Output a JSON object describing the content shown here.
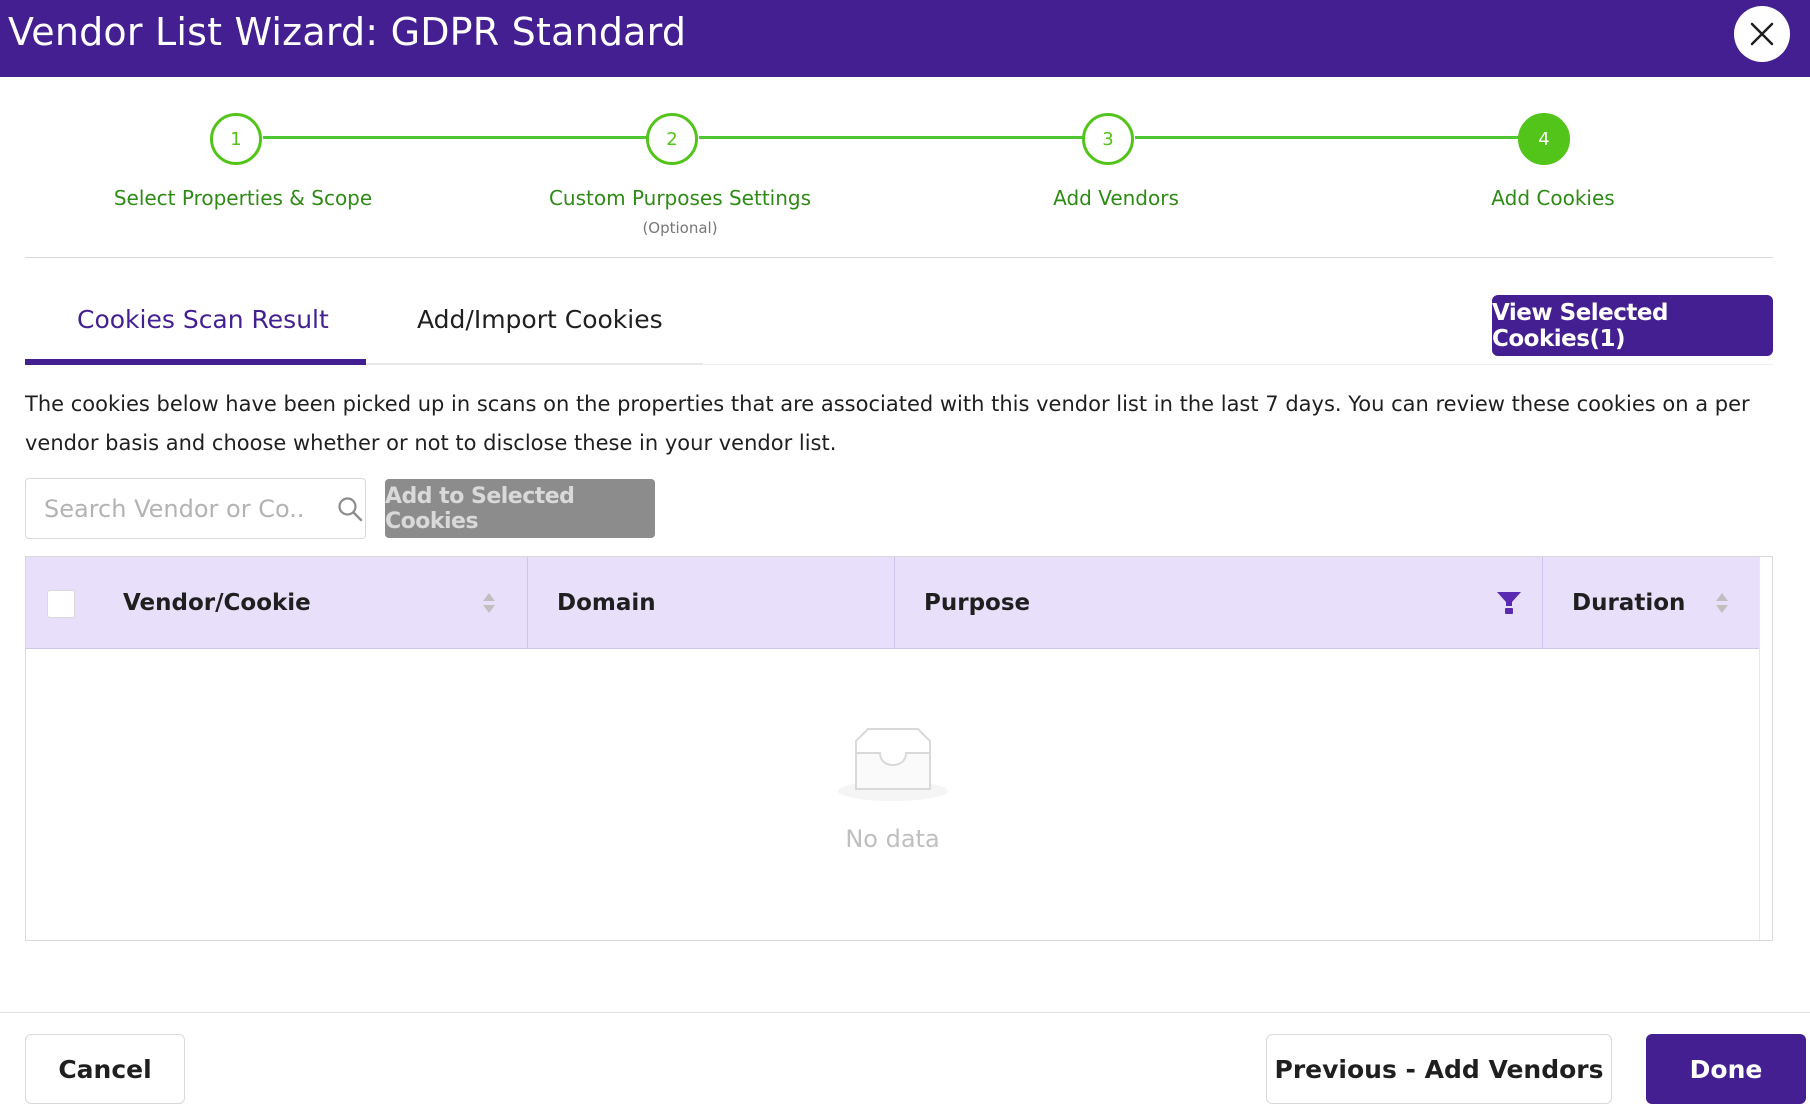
{
  "header": {
    "title": "Vendor List Wizard: GDPR Standard",
    "close_icon": "close-icon"
  },
  "stepper": {
    "steps": [
      {
        "number": "1",
        "label": "Select Properties & Scope",
        "sub": ""
      },
      {
        "number": "2",
        "label": "Custom Purposes Settings",
        "sub": "(Optional)"
      },
      {
        "number": "3",
        "label": "Add Vendors",
        "sub": ""
      },
      {
        "number": "4",
        "label": "Add Cookies",
        "sub": ""
      }
    ],
    "active_step": 4
  },
  "tabs": [
    {
      "label": "Cookies Scan Result",
      "active": true
    },
    {
      "label": "Add/Import Cookies",
      "active": false
    }
  ],
  "view_selected_label": "View Selected Cookies(1)",
  "description": "The cookies below have been picked up in scans on the properties that are associated with this vendor list in the last 7 days. You can review these cookies on a per vendor basis and choose whether or not to disclose these in your vendor list.",
  "search": {
    "placeholder": "Search Vendor or Co..."
  },
  "add_selected_label": "Add to Selected Cookies",
  "table": {
    "columns": [
      "Vendor/Cookie",
      "Domain",
      "Purpose",
      "Duration"
    ],
    "rows": [],
    "empty_text": "No data"
  },
  "footer": {
    "cancel_label": "Cancel",
    "previous_label": "Previous - Add Vendors",
    "done_label": "Done"
  },
  "colors": {
    "brand": "#441f91",
    "step_green": "#52c41a",
    "header_bg": "#e8e0fb",
    "disabled": "#8c8c8c"
  }
}
